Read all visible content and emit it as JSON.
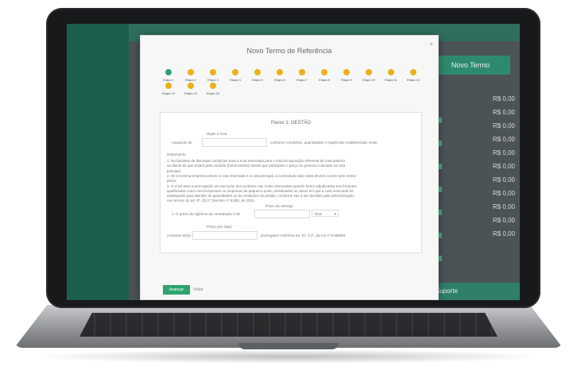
{
  "modal": {
    "title": "Novo Termo de Referência",
    "close_glyph": "×",
    "steps": [
      {
        "label": "Etapa 1",
        "done": true
      },
      {
        "label": "Etapa 2",
        "done": false
      },
      {
        "label": "Etapa 3",
        "done": false
      },
      {
        "label": "Etapa 4",
        "done": false
      },
      {
        "label": "Etapa 5",
        "done": false
      },
      {
        "label": "Etapa 6",
        "done": false
      },
      {
        "label": "Etapa 7",
        "done": false
      },
      {
        "label": "Etapa 8",
        "done": false
      },
      {
        "label": "Etapa 9",
        "done": false
      },
      {
        "label": "Etapa 10",
        "done": false
      },
      {
        "label": "Etapa 11",
        "done": false
      },
      {
        "label": "Etapa 12",
        "done": false
      },
      {
        "label": "Etapa 14",
        "done": false
      },
      {
        "label": "Etapa 15",
        "done": false
      },
      {
        "label": "Etapa 16",
        "done": false
      }
    ],
    "panel_header": "Passo 1: GESTÃO",
    "field_label_1": "Digite a hora",
    "input_prefix": "Aquisição de",
    "input_suffix": "conforme condições, quantidades e exigências estabelecidas neste",
    "section_label": "instrumento",
    "paragraphs": [
      "1. Na hipótese de discrepar condições para a nota reservada para o total da aquisição referente de nota anterior",
      "ou diante de que estará pela unidade (fornecimento) desde que participem o preço do primeiro colocado na cota",
      "principal.",
      "2. Se a mesma empresa vencer a cota reservada e a cota principal, a contratação das cotas deverá ocorrer pelo menor",
      "preço.",
      "3. O nível para a prorrogação da execução dos produtos nas notas reservadas quando forem adjudicados aos licitantes",
      "qualificados como microempresas ou empresas de pequeno porte, ressalvados os casos em que a cota reservada for",
      "inadequada para atender as quantidades ou às condições do pedido, conforme vier a ser decidido pela administração,",
      "nos termos do art. 8º, §§ 2º, Decreto nº 8.538, de 2015."
    ],
    "select_label": "Prazo de entrega",
    "select_prefix": "1. O prazo de vigência da contratação é de",
    "select_value": "Dias",
    "field_label_2": "Prazo (em dias)",
    "period_prefix": "contados do(a)",
    "period_suffix": "prorrogável conforme art. 57, § 1º, da Lei nº 8.666/93.",
    "next_button": "Avançar",
    "back_link": "Voltar"
  },
  "background_app": {
    "top_button": "Novo Termo",
    "row_values": [
      "R$ 0,00",
      "R$ 0,00",
      "R$ 0,00",
      "R$ 0,00",
      "R$ 0,00",
      "R$ 0,00",
      "R$ 0,00",
      "R$ 0,00",
      "R$ 0,00",
      "R$ 0,00",
      "R$ 0,00"
    ],
    "footer_label": "Suporte"
  }
}
